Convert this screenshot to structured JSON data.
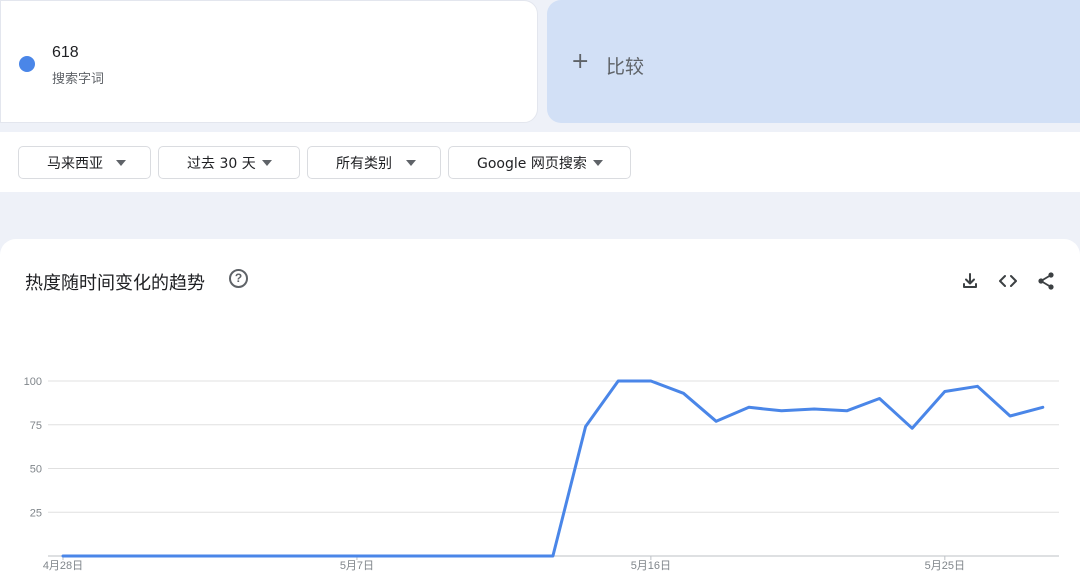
{
  "search_term": {
    "name": "618",
    "subtitle": "搜索字词",
    "color": "#4a86e8"
  },
  "compare": {
    "icon": "plus-icon",
    "label": "比较"
  },
  "filters": {
    "region": "马来西亚",
    "time_range": "过去 30 天",
    "category": "所有类别",
    "search_type": "Google 网页搜索"
  },
  "chart_panel": {
    "title": "热度随时间变化的趋势",
    "icons": [
      "help-icon",
      "download-icon",
      "embed-icon",
      "share-icon"
    ]
  },
  "chart_data": {
    "type": "line",
    "x": [
      "4月28日",
      "4月29日",
      "4月30日",
      "5月1日",
      "5月2日",
      "5月3日",
      "5月4日",
      "5月5日",
      "5月6日",
      "5月7日",
      "5月8日",
      "5月9日",
      "5月10日",
      "5月11日",
      "5月12日",
      "5月13日",
      "5月14日",
      "5月15日",
      "5月16日",
      "5月17日",
      "5月18日",
      "5月19日",
      "5月20日",
      "5月21日",
      "5月22日",
      "5月23日",
      "5月24日",
      "5月25日",
      "5月26日",
      "5月27日"
    ],
    "x_tick_labels": [
      "4月28日",
      "5月7日",
      "5月16日",
      "5月25日"
    ],
    "series": [
      {
        "color": "#4a86e8",
        "values": [
          0,
          0,
          0,
          0,
          0,
          0,
          0,
          0,
          0,
          0,
          0,
          0,
          0,
          0,
          0,
          0,
          74,
          100,
          100,
          93,
          77,
          85,
          83,
          84,
          83,
          90,
          73,
          94,
          97,
          80,
          85
        ]
      }
    ],
    "y_ticks": [
      25,
      50,
      75,
      100
    ],
    "ylim": [
      0,
      100
    ],
    "grid": true
  }
}
